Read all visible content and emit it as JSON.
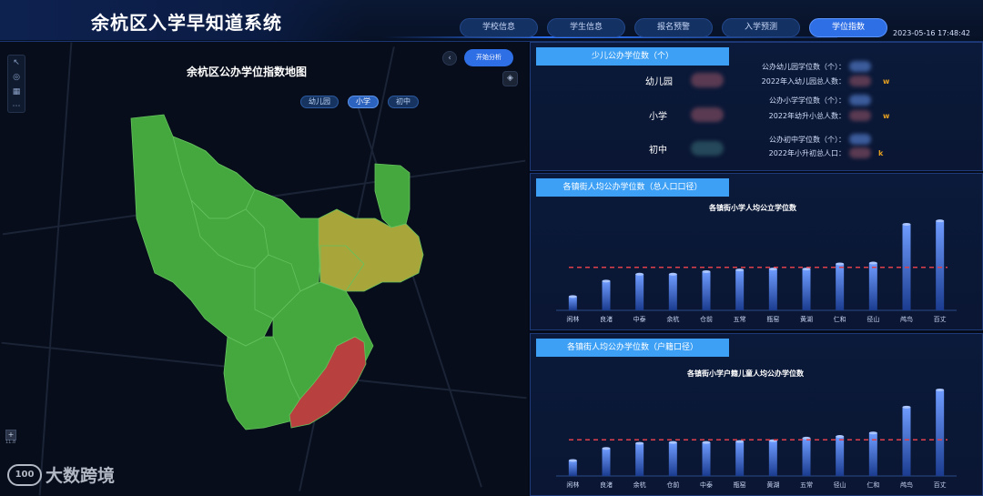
{
  "header": {
    "title": "余杭区入学早知道系统",
    "datetime": "2023-05-16 17:48:42",
    "tabs": [
      {
        "label": "学校信息",
        "active": false
      },
      {
        "label": "学生信息",
        "active": false
      },
      {
        "label": "报名预警",
        "active": false
      },
      {
        "label": "入学预测",
        "active": false
      },
      {
        "label": "学位指数",
        "active": true
      }
    ]
  },
  "map": {
    "title": "余杭区公办学位指数地图",
    "analysis_button": "开始分析",
    "levels": [
      {
        "label": "幼儿园",
        "active": false
      },
      {
        "label": "小学",
        "active": true
      },
      {
        "label": "初中",
        "active": false
      }
    ],
    "zoom_level": "11.8",
    "region_colors": {
      "good": "#44a83f",
      "warning": "#a8a63a",
      "danger": "#b8403f"
    }
  },
  "watermark": {
    "logo": "100",
    "brand": "大数跨境"
  },
  "seats": {
    "title": "少儿公办学位数（个）",
    "levels": [
      "幼儿园",
      "小学",
      "初中"
    ],
    "stats": [
      {
        "label": "公办幼儿园学位数（个）：",
        "unit": ""
      },
      {
        "label": "2022年入幼儿园总人数：",
        "unit": "w"
      },
      {
        "label": "公办小学学位数（个）：",
        "unit": ""
      },
      {
        "label": "2022年幼升小总人数：",
        "unit": "w"
      },
      {
        "label": "公办初中学位数（个）：",
        "unit": ""
      },
      {
        "label": "2022年小升初总人口：",
        "unit": "k"
      }
    ]
  },
  "panel_total": {
    "title": "各镇街人均公办学位数（总人口口径）"
  },
  "panel_household": {
    "title": "各镇街人均公办学位数（户籍口径）"
  },
  "chart_data": [
    {
      "type": "bar",
      "title": "各镇街小学人均公立学位数",
      "categories": [
        "闲林",
        "良渚",
        "中泰",
        "余杭",
        "仓前",
        "五常",
        "瓶窑",
        "黄湖",
        "仁和",
        "径山",
        "鸬鸟",
        "百丈"
      ],
      "values": [
        0.16,
        0.34,
        0.42,
        0.42,
        0.45,
        0.47,
        0.48,
        0.48,
        0.54,
        0.55,
        1.0,
        1.04
      ],
      "reference_line": 0.5,
      "ylim": [
        0,
        1.1
      ],
      "grid": false,
      "colors": {
        "bar_top": "#6f9cff",
        "bar_bottom": "#1b3c8f",
        "reference": "#e0404a"
      }
    },
    {
      "type": "bar",
      "title": "各镇街小学户籍儿童人均公办学位数",
      "categories": [
        "闲林",
        "良渚",
        "余杭",
        "仓前",
        "中泰",
        "瓶窑",
        "黄湖",
        "五常",
        "径山",
        "仁和",
        "鸬鸟",
        "百丈"
      ],
      "values": [
        0.18,
        0.32,
        0.38,
        0.39,
        0.39,
        0.4,
        0.41,
        0.44,
        0.46,
        0.5,
        0.8,
        1.0
      ],
      "reference_line": 0.42,
      "ylim": [
        0,
        1.1
      ],
      "grid": false,
      "colors": {
        "bar_top": "#6f9cff",
        "bar_bottom": "#1b3c8f",
        "reference": "#e0404a"
      }
    }
  ]
}
